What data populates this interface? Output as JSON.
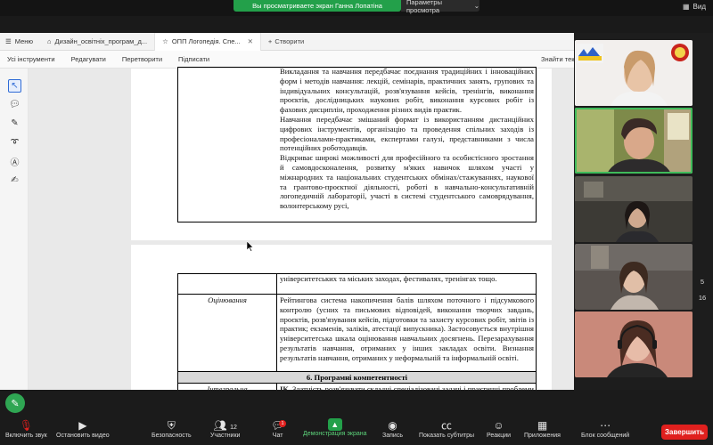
{
  "zoom_top": {
    "banner": "Вы просматриваете экран Ганна Лопатіна",
    "options": "Параметры просмотра",
    "view": "Вид"
  },
  "browser_tabs": {
    "menu": "Меню",
    "tabs": [
      {
        "label": "Дизайн_освітніх_програм_д..."
      },
      {
        "label": "ОПП Логопедія. Спе..."
      }
    ],
    "new_tab": "Створити"
  },
  "ribbon": {
    "items": [
      "Усі інструменти",
      "Редагувати",
      "Перетворити",
      "Підписати"
    ],
    "find": "Знайти тек"
  },
  "document": {
    "page1_paragraphs": [
      "Викладання та навчання передбачає поєднання традиційних і інноваційних форм і методів навчання: лекцій, семінарів, практичних занять, групових та індивідуальних консультацій, розв'язування кейсів, тренінгів, виконання проєктів, дослідницьких наукових робіт, виконання курсових робіт із фахових дисциплін, проходження різних видів практик.",
      "Навчання передбачає змішаний формат із використанням дистанційних цифрових інструментів, організацію та проведення спільних заходів із професіоналами-практиками, експертами галузі, представниками з числа потенційних роботодавців.",
      "Відкриває широкі можливості для професійного та особистісного зростання й самовдосконалення, розвитку м'яких навичок шляхом участі у міжнародних та національних студентських обмінах/стажуваннях, наукової та грантово-проєктної діяльності, роботі в навчально-консультативній логопедичній лабораторії, участі в системі студентського самоврядування, волонтерському русі,"
    ],
    "page2_continuation": "університетських та міських заходах, фестивалях, тренінгах тощо.",
    "assessment_label": "Оцінювання",
    "assessment_text": "Рейтингова система накопичення балів шляхом поточного і підсумкового контролю (усних та письмових відповідей, виконання творчих завдань, проєктів, розв'язування кейсів, підготовки та захисту курсових робіт, звітів із практик; екзаменів, заліків, атестації випускника). Застосовується внутрішня університетська шкала оцінювання навчальних досягнень. Перезарахування результатів навчання, отриманих у інших закладах освіти. Визнання результатів навчання, отриманих у неформальній та інформальній освіті.",
    "section_heading": "6. Програмні компетентності",
    "integral_label": "Інтегральна компетентність (ІК)",
    "integral_text_bold": "ІК.",
    "integral_text": " Здатність розв'язувати складні спеціалізовані задачі і практичні проблеми спеціальної та інклюзивної освіти у процесі корекційно-педагогічної, діагностико-консультативної, дослідницької та"
  },
  "page_numbers": [
    "5",
    "16"
  ],
  "toolbar": {
    "mute": "Включить звук",
    "video": "Остановить видео",
    "security": "Безопасность",
    "participants": "Участники",
    "participants_count": "12",
    "chat": "Чат",
    "chat_badge": "1",
    "share": "Демонстрация экрана",
    "record": "Запись",
    "captions": "Показать субтитры",
    "reactions": "Реакции",
    "apps": "Приложения",
    "more": "Блок сообщений",
    "end": "Завершить"
  },
  "colors": {
    "share_green": "#23a04a",
    "end_red": "#e0201e",
    "active_tile": "#3fbb5a"
  }
}
